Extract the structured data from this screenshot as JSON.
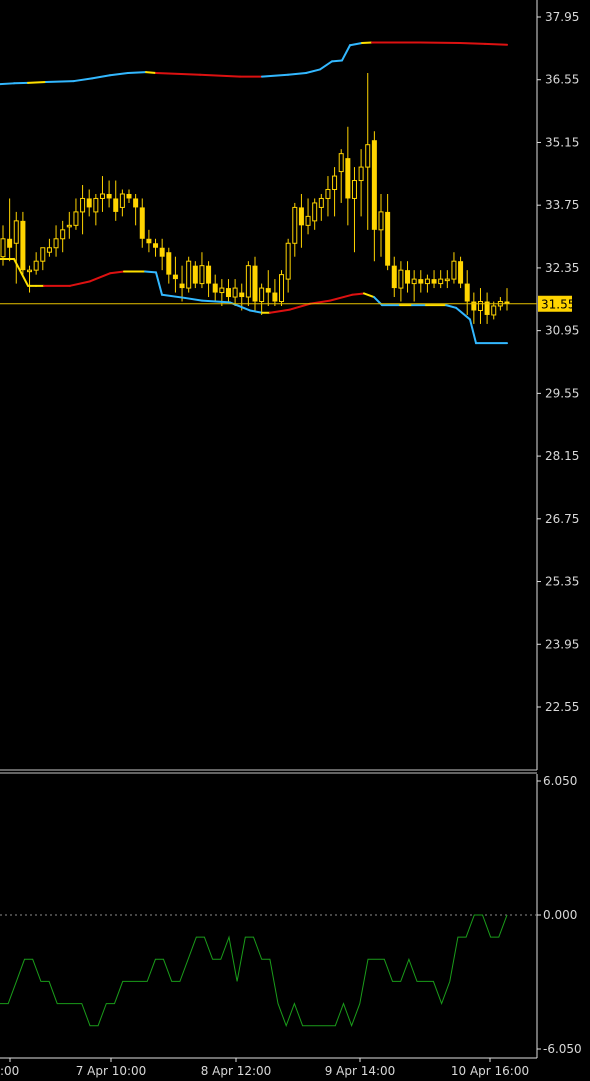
{
  "chart_data": [
    {
      "type": "candlestick",
      "title": "",
      "ylim": [
        19.47,
        38.47
      ],
      "y_ticks": [
        "37.95",
        "36.55",
        "35.15",
        "33.75",
        "32.35",
        "30.95",
        "29.55",
        "28.15",
        "26.75",
        "25.35",
        "23.95",
        "22.55"
      ],
      "current_price": "31.55",
      "price_line_color": "#e8c200",
      "candle_color": "#ffd400",
      "candles": [
        [
          32.6,
          33.3,
          32.4,
          33.0
        ],
        [
          33.0,
          33.9,
          32.5,
          32.8
        ],
        [
          32.9,
          33.6,
          32.0,
          33.4
        ],
        [
          33.4,
          33.6,
          32.2,
          32.3
        ],
        [
          32.3,
          32.4,
          31.8,
          32.3
        ],
        [
          32.3,
          32.7,
          32.2,
          32.5
        ],
        [
          32.5,
          32.8,
          32.3,
          32.8
        ],
        [
          32.7,
          33.0,
          32.6,
          32.8
        ],
        [
          32.8,
          33.3,
          32.6,
          33.0
        ],
        [
          33.0,
          33.4,
          32.7,
          33.2
        ],
        [
          33.3,
          33.6,
          33.0,
          33.3
        ],
        [
          33.3,
          33.9,
          33.2,
          33.6
        ],
        [
          33.6,
          34.2,
          33.1,
          33.9
        ],
        [
          33.9,
          34.1,
          33.5,
          33.7
        ],
        [
          33.6,
          34.0,
          33.3,
          33.9
        ],
        [
          33.9,
          34.4,
          33.6,
          34.0
        ],
        [
          34.0,
          34.3,
          33.7,
          33.9
        ],
        [
          33.9,
          34.3,
          33.4,
          33.6
        ],
        [
          33.7,
          34.1,
          33.5,
          34.0
        ],
        [
          34.0,
          34.1,
          33.8,
          33.9
        ],
        [
          33.9,
          34.0,
          33.3,
          33.7
        ],
        [
          33.7,
          33.9,
          32.8,
          33.0
        ],
        [
          33.0,
          33.2,
          32.7,
          32.9
        ],
        [
          32.9,
          33.0,
          32.6,
          32.8
        ],
        [
          32.8,
          33.0,
          32.3,
          32.6
        ],
        [
          32.7,
          32.8,
          32.0,
          32.2
        ],
        [
          32.2,
          32.6,
          31.8,
          32.1
        ],
        [
          32.0,
          32.4,
          31.6,
          31.9
        ],
        [
          31.9,
          32.6,
          31.8,
          32.5
        ],
        [
          32.4,
          32.5,
          31.9,
          32.0
        ],
        [
          32.0,
          32.7,
          31.9,
          32.4
        ],
        [
          32.4,
          32.5,
          31.7,
          32.0
        ],
        [
          32.0,
          32.2,
          31.6,
          31.8
        ],
        [
          31.8,
          32.1,
          31.5,
          31.9
        ],
        [
          31.9,
          32.1,
          31.6,
          31.7
        ],
        [
          31.7,
          32.1,
          31.5,
          31.9
        ],
        [
          31.8,
          32.0,
          31.4,
          31.7
        ],
        [
          31.7,
          32.5,
          31.5,
          32.4
        ],
        [
          32.4,
          32.6,
          31.4,
          31.6
        ],
        [
          31.6,
          32.0,
          31.3,
          31.9
        ],
        [
          31.9,
          32.3,
          31.5,
          31.8
        ],
        [
          31.8,
          32.1,
          31.5,
          31.6
        ],
        [
          31.6,
          32.3,
          31.5,
          32.2
        ],
        [
          32.1,
          33.0,
          31.8,
          32.9
        ],
        [
          32.9,
          33.8,
          32.6,
          33.7
        ],
        [
          33.7,
          34.0,
          32.8,
          33.3
        ],
        [
          33.3,
          33.9,
          33.1,
          33.5
        ],
        [
          33.4,
          33.9,
          33.2,
          33.8
        ],
        [
          33.7,
          34.0,
          33.4,
          33.9
        ],
        [
          33.9,
          34.4,
          33.5,
          34.1
        ],
        [
          34.1,
          34.6,
          33.5,
          34.4
        ],
        [
          34.5,
          35.0,
          33.8,
          34.9
        ],
        [
          34.8,
          35.5,
          33.3,
          33.9
        ],
        [
          33.9,
          34.6,
          32.7,
          34.3
        ],
        [
          34.3,
          35.0,
          33.5,
          34.6
        ],
        [
          34.6,
          36.7,
          33.2,
          35.1
        ],
        [
          35.2,
          35.4,
          32.5,
          33.2
        ],
        [
          33.2,
          34.0,
          32.6,
          33.6
        ],
        [
          33.6,
          34.0,
          32.3,
          32.4
        ],
        [
          32.4,
          32.6,
          31.7,
          31.9
        ],
        [
          31.9,
          32.5,
          31.6,
          32.3
        ],
        [
          32.3,
          32.5,
          31.8,
          32.0
        ],
        [
          32.0,
          32.3,
          31.6,
          32.1
        ],
        [
          32.1,
          32.3,
          31.8,
          32.0
        ],
        [
          32.0,
          32.2,
          31.8,
          32.1
        ],
        [
          32.1,
          32.3,
          31.9,
          32.0
        ],
        [
          32.0,
          32.3,
          31.9,
          32.1
        ],
        [
          32.1,
          32.3,
          31.9,
          32.1
        ],
        [
          32.1,
          32.7,
          32.0,
          32.5
        ],
        [
          32.5,
          32.6,
          31.9,
          32.0
        ],
        [
          32.0,
          32.3,
          31.3,
          31.6
        ],
        [
          31.6,
          31.8,
          31.1,
          31.4
        ],
        [
          31.4,
          31.9,
          31.1,
          31.6
        ],
        [
          31.6,
          31.8,
          31.1,
          31.3
        ],
        [
          31.3,
          31.6,
          31.2,
          31.5
        ],
        [
          31.5,
          31.7,
          31.4,
          31.6
        ],
        [
          31.6,
          31.9,
          31.4,
          31.55
        ]
      ],
      "upper_band": {
        "colors": [
          "#33b8ff",
          "#ffe000",
          "#dd1111"
        ],
        "points": [
          [
            -2,
            36.45,
            0
          ],
          [
            14,
            36.47,
            0
          ],
          [
            28,
            36.48,
            1
          ],
          [
            46,
            36.5,
            0
          ],
          [
            74,
            36.52,
            0
          ],
          [
            92,
            36.58,
            0
          ],
          [
            110,
            36.65,
            0
          ],
          [
            128,
            36.7,
            0
          ],
          [
            146,
            36.72,
            1
          ],
          [
            156,
            36.7,
            2
          ],
          [
            200,
            36.66,
            2
          ],
          [
            240,
            36.62,
            2
          ],
          [
            262,
            36.62,
            0
          ],
          [
            288,
            36.66,
            0
          ],
          [
            306,
            36.7,
            0
          ],
          [
            320,
            36.78,
            0
          ],
          [
            332,
            36.96,
            0
          ],
          [
            342,
            36.98,
            0
          ],
          [
            350,
            37.32,
            0
          ],
          [
            362,
            37.37,
            1
          ],
          [
            372,
            37.38,
            2
          ],
          [
            420,
            37.38,
            2
          ],
          [
            460,
            37.37,
            2
          ],
          [
            485,
            37.35,
            2
          ],
          [
            507,
            37.33,
            2
          ]
        ]
      },
      "lower_band": {
        "colors": [
          "#33b8ff",
          "#ffe000",
          "#dd1111"
        ],
        "points": [
          [
            -2,
            32.55,
            1
          ],
          [
            14,
            32.55,
            1
          ],
          [
            28,
            31.95,
            1
          ],
          [
            36,
            31.95,
            1
          ],
          [
            44,
            31.95,
            2
          ],
          [
            70,
            31.95,
            2
          ],
          [
            90,
            32.05,
            2
          ],
          [
            110,
            32.23,
            2
          ],
          [
            124,
            32.27,
            1
          ],
          [
            145,
            32.27,
            0
          ],
          [
            156,
            32.25,
            0
          ],
          [
            162,
            31.75,
            0
          ],
          [
            185,
            31.68,
            0
          ],
          [
            202,
            31.62,
            0
          ],
          [
            230,
            31.58,
            0
          ],
          [
            250,
            31.4,
            0
          ],
          [
            262,
            31.35,
            1
          ],
          [
            270,
            31.35,
            2
          ],
          [
            290,
            31.42,
            2
          ],
          [
            310,
            31.55,
            2
          ],
          [
            330,
            31.62,
            2
          ],
          [
            352,
            31.75,
            2
          ],
          [
            364,
            31.78,
            1
          ],
          [
            374,
            31.7,
            0
          ],
          [
            382,
            31.52,
            0
          ],
          [
            400,
            31.52,
            1
          ],
          [
            412,
            31.52,
            0
          ],
          [
            426,
            31.52,
            1
          ],
          [
            446,
            31.52,
            0
          ],
          [
            456,
            31.46,
            0
          ],
          [
            470,
            31.2,
            0
          ],
          [
            476,
            30.67,
            0
          ],
          [
            507,
            30.67,
            0
          ]
        ]
      },
      "x_categories": [
        ":00",
        "7 Apr 10:00",
        "8 Apr 12:00",
        "9 Apr 14:00",
        "10 Apr 16:00"
      ]
    },
    {
      "type": "line",
      "title": "",
      "ylim": [
        -6.05,
        6.05
      ],
      "y_ticks": [
        "6.050",
        "0.000",
        "-6.050"
      ],
      "zero_line": 0,
      "line_color": "#1a9c1a",
      "series": [
        {
          "values": [
            -4,
            -4,
            -3,
            -2,
            -2,
            -3,
            -3,
            -4,
            -4,
            -4,
            -4,
            -5,
            -5,
            -4,
            -4,
            -3,
            -3,
            -3,
            -3,
            -2,
            -2,
            -3,
            -3,
            -2,
            -1,
            -1,
            -2,
            -2,
            -1,
            -3,
            -1,
            -1,
            -2,
            -2,
            -4,
            -5,
            -4,
            -5,
            -5,
            -5,
            -5,
            -5,
            -4,
            -5,
            -4,
            -2,
            -2,
            -2,
            -3,
            -3,
            -2,
            -3,
            -3,
            -3,
            -4,
            -3,
            -1,
            -1,
            0,
            0,
            -1,
            -1,
            0
          ]
        }
      ]
    }
  ]
}
